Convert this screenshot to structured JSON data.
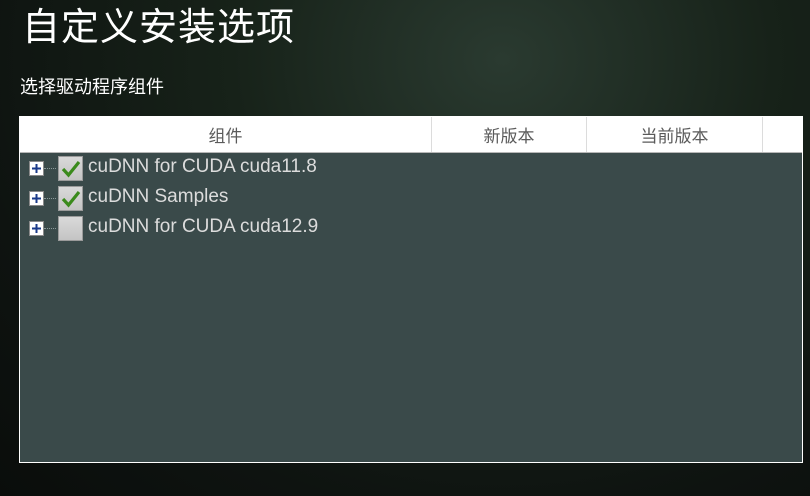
{
  "page": {
    "title": "自定义安装选项",
    "subtitle": "选择驱动程序组件"
  },
  "table": {
    "columns": [
      "组件",
      "新版本",
      "当前版本",
      ""
    ],
    "rows": [
      {
        "label": "cuDNN for CUDA cuda11.8",
        "checked": true,
        "new_version": "",
        "current_version": ""
      },
      {
        "label": "cuDNN Samples",
        "checked": true,
        "new_version": "",
        "current_version": ""
      },
      {
        "label": "cuDNN for CUDA cuda12.9",
        "checked": false,
        "new_version": "",
        "current_version": ""
      }
    ]
  },
  "colors": {
    "panel_bg": "#3a4a4a",
    "check_green": "#3a8a1c",
    "text_light": "#dcdcdc"
  },
  "icons": {
    "expander": "plus-icon",
    "check": "checkmark-icon"
  }
}
